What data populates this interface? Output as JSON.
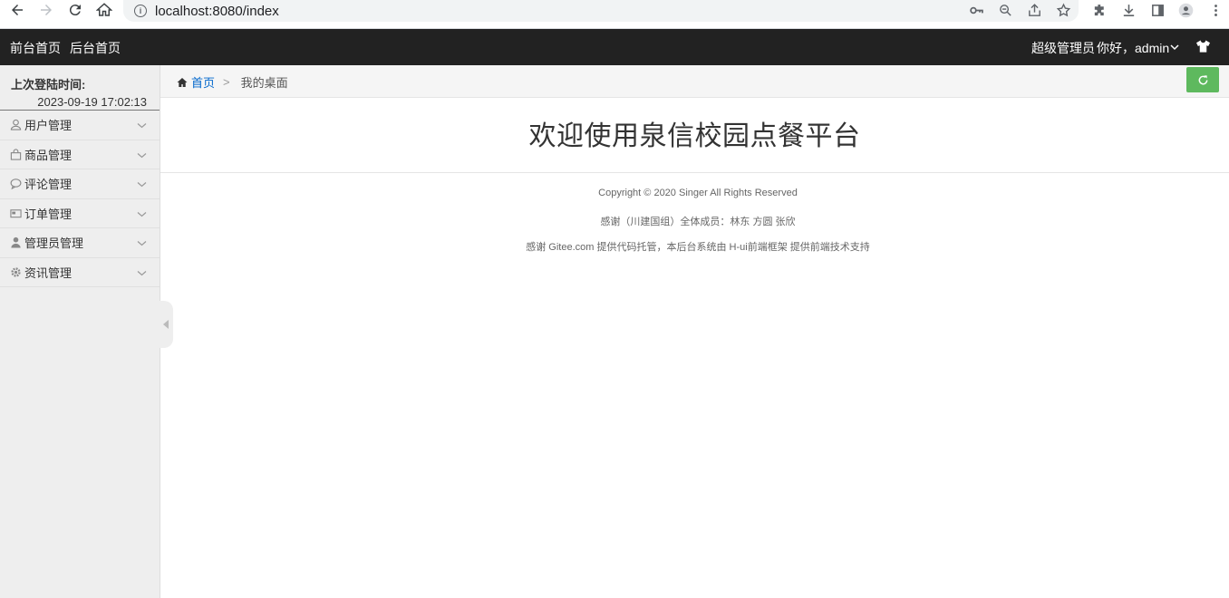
{
  "browser": {
    "url": "localhost:8080/index"
  },
  "topbar": {
    "front_home": "前台首页",
    "back_home": "后台首页",
    "role": "超级管理员",
    "greeting": "你好，admin"
  },
  "sidebar": {
    "last_login_label": "上次登陆时间:",
    "last_login_time": "2023-09-19 17:02:13",
    "items": [
      {
        "label": "用户管理",
        "icon": "user-icon"
      },
      {
        "label": "商品管理",
        "icon": "bag-icon"
      },
      {
        "label": "评论管理",
        "icon": "comment-icon"
      },
      {
        "label": "订单管理",
        "icon": "card-icon"
      },
      {
        "label": "管理员管理",
        "icon": "admin-icon"
      },
      {
        "label": "资讯管理",
        "icon": "gear-icon"
      }
    ]
  },
  "breadcrumb": {
    "home": "首页",
    "separator": ">",
    "current": "我的桌面"
  },
  "main": {
    "welcome": "欢迎使用泉信校园点餐平台",
    "footer": [
      "Copyright © 2020 Singer All Rights Reserved",
      "感谢（川建国组）全体成员：林东 方圆 张欣",
      "感谢 Gitee.com 提供代码托管，本后台系统由 H-ui前端框架 提供前端技术支持"
    ]
  },
  "colors": {
    "topbar_bg": "#222222",
    "sidebar_bg": "#eeeeee",
    "refresh_button": "#5eb95e",
    "link": "#0066cc"
  }
}
